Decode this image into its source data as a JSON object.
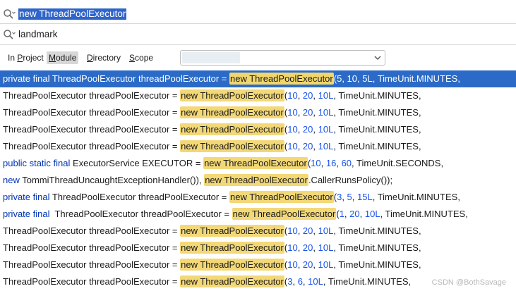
{
  "search": {
    "query": "new ThreadPoolExecutor",
    "secondary_query": "landmark"
  },
  "scope": {
    "tabs": [
      {
        "label": "In Project",
        "underline": "P",
        "active": false
      },
      {
        "label": "Module",
        "underline": "M",
        "active": true
      },
      {
        "label": "Directory",
        "underline": "D",
        "active": false
      },
      {
        "label": "Scope",
        "underline": "S",
        "active": false
      }
    ]
  },
  "results": [
    [
      [
        "kw",
        "private final "
      ],
      [
        "t",
        "ThreadPoolExecutor threadPoolExecutor = "
      ],
      [
        "hl",
        "new ThreadPoolExecutor"
      ],
      [
        "t",
        "("
      ],
      [
        "num",
        "5"
      ],
      [
        "t",
        ", "
      ],
      [
        "num",
        "10"
      ],
      [
        "t",
        ", "
      ],
      [
        "num",
        "5L"
      ],
      [
        "t",
        ", TimeUnit.MINUTES,"
      ]
    ],
    [
      [
        "t",
        "ThreadPoolExecutor threadPoolExecutor = "
      ],
      [
        "hl",
        "new ThreadPoolExecutor"
      ],
      [
        "t",
        "("
      ],
      [
        "num",
        "10"
      ],
      [
        "t",
        ", "
      ],
      [
        "num",
        "20"
      ],
      [
        "t",
        ", "
      ],
      [
        "num",
        "10L"
      ],
      [
        "t",
        ", TimeUnit.MINUTES,"
      ]
    ],
    [
      [
        "t",
        "ThreadPoolExecutor threadPoolExecutor = "
      ],
      [
        "hl",
        "new ThreadPoolExecutor"
      ],
      [
        "t",
        "("
      ],
      [
        "num",
        "10"
      ],
      [
        "t",
        ", "
      ],
      [
        "num",
        "20"
      ],
      [
        "t",
        ", "
      ],
      [
        "num",
        "10L"
      ],
      [
        "t",
        ", TimeUnit.MINUTES,"
      ]
    ],
    [
      [
        "t",
        "ThreadPoolExecutor threadPoolExecutor = "
      ],
      [
        "hl",
        "new ThreadPoolExecutor"
      ],
      [
        "t",
        "("
      ],
      [
        "num",
        "10"
      ],
      [
        "t",
        ", "
      ],
      [
        "num",
        "20"
      ],
      [
        "t",
        ", "
      ],
      [
        "num",
        "10L"
      ],
      [
        "t",
        ", TimeUnit.MINUTES,"
      ]
    ],
    [
      [
        "t",
        "ThreadPoolExecutor threadPoolExecutor = "
      ],
      [
        "hl",
        "new ThreadPoolExecutor"
      ],
      [
        "t",
        "("
      ],
      [
        "num",
        "10"
      ],
      [
        "t",
        ", "
      ],
      [
        "num",
        "20"
      ],
      [
        "t",
        ", "
      ],
      [
        "num",
        "10L"
      ],
      [
        "t",
        ", TimeUnit.MINUTES,"
      ]
    ],
    [
      [
        "kw",
        "public static final "
      ],
      [
        "t",
        "ExecutorService EXECUTOR = "
      ],
      [
        "hl",
        "new ThreadPoolExecutor"
      ],
      [
        "t",
        "("
      ],
      [
        "num",
        "10"
      ],
      [
        "t",
        ", "
      ],
      [
        "num",
        "16"
      ],
      [
        "t",
        ", "
      ],
      [
        "num",
        "60"
      ],
      [
        "t",
        ", TimeUnit.SECONDS,"
      ]
    ],
    [
      [
        "kw",
        "new "
      ],
      [
        "t",
        "TommiThreadUncaughtExceptionHandler()), "
      ],
      [
        "hl",
        "new ThreadPoolExecutor"
      ],
      [
        "t",
        ".CallerRunsPolicy());"
      ]
    ],
    [
      [
        "kw",
        "private final "
      ],
      [
        "t",
        "ThreadPoolExecutor threadPoolExecutor = "
      ],
      [
        "hl",
        "new ThreadPoolExecutor"
      ],
      [
        "t",
        "("
      ],
      [
        "num",
        "3"
      ],
      [
        "t",
        ", "
      ],
      [
        "num",
        "5"
      ],
      [
        "t",
        ", "
      ],
      [
        "num",
        "15L"
      ],
      [
        "t",
        ", TimeUnit.MINUTES,"
      ]
    ],
    [
      [
        "kw",
        "private final  "
      ],
      [
        "t",
        "ThreadPoolExecutor threadPoolExecutor = "
      ],
      [
        "hl",
        "new ThreadPoolExecutor"
      ],
      [
        "t",
        "("
      ],
      [
        "num",
        "1"
      ],
      [
        "t",
        ", "
      ],
      [
        "num",
        "20"
      ],
      [
        "t",
        ", "
      ],
      [
        "num",
        "10L"
      ],
      [
        "t",
        ", TimeUnit.MINUTES,"
      ]
    ],
    [
      [
        "t",
        "ThreadPoolExecutor threadPoolExecutor = "
      ],
      [
        "hl",
        "new ThreadPoolExecutor"
      ],
      [
        "t",
        "("
      ],
      [
        "num",
        "10"
      ],
      [
        "t",
        ", "
      ],
      [
        "num",
        "20"
      ],
      [
        "t",
        ", "
      ],
      [
        "num",
        "10L"
      ],
      [
        "t",
        ", TimeUnit.MINUTES,"
      ]
    ],
    [
      [
        "t",
        "ThreadPoolExecutor threadPoolExecutor = "
      ],
      [
        "hl",
        "new ThreadPoolExecutor"
      ],
      [
        "t",
        "("
      ],
      [
        "num",
        "10"
      ],
      [
        "t",
        ", "
      ],
      [
        "num",
        "20"
      ],
      [
        "t",
        ", "
      ],
      [
        "num",
        "10L"
      ],
      [
        "t",
        ", TimeUnit.MINUTES,"
      ]
    ],
    [
      [
        "t",
        "ThreadPoolExecutor threadPoolExecutor = "
      ],
      [
        "hl",
        "new ThreadPoolExecutor"
      ],
      [
        "t",
        "("
      ],
      [
        "num",
        "10"
      ],
      [
        "t",
        ", "
      ],
      [
        "num",
        "20"
      ],
      [
        "t",
        ", "
      ],
      [
        "num",
        "10L"
      ],
      [
        "t",
        ", TimeUnit.MINUTES,"
      ]
    ],
    [
      [
        "t",
        "ThreadPoolExecutor threadPoolExecutor = "
      ],
      [
        "hl",
        "new ThreadPoolExecutor"
      ],
      [
        "t",
        "("
      ],
      [
        "num",
        "3"
      ],
      [
        "t",
        ", "
      ],
      [
        "num",
        "6"
      ],
      [
        "t",
        ", "
      ],
      [
        "num",
        "10L"
      ],
      [
        "t",
        ", TimeUnit.MINUTES,"
      ]
    ]
  ],
  "selected_result": 0,
  "watermark": "CSDN @BothSavage",
  "colors": {
    "selection": "#2b6ac7",
    "match_highlight": "#f3d878",
    "keyword": "#0033b3",
    "number": "#1750eb"
  },
  "icons": {
    "search": "search-icon",
    "dropdown": "chevron-down-icon"
  }
}
